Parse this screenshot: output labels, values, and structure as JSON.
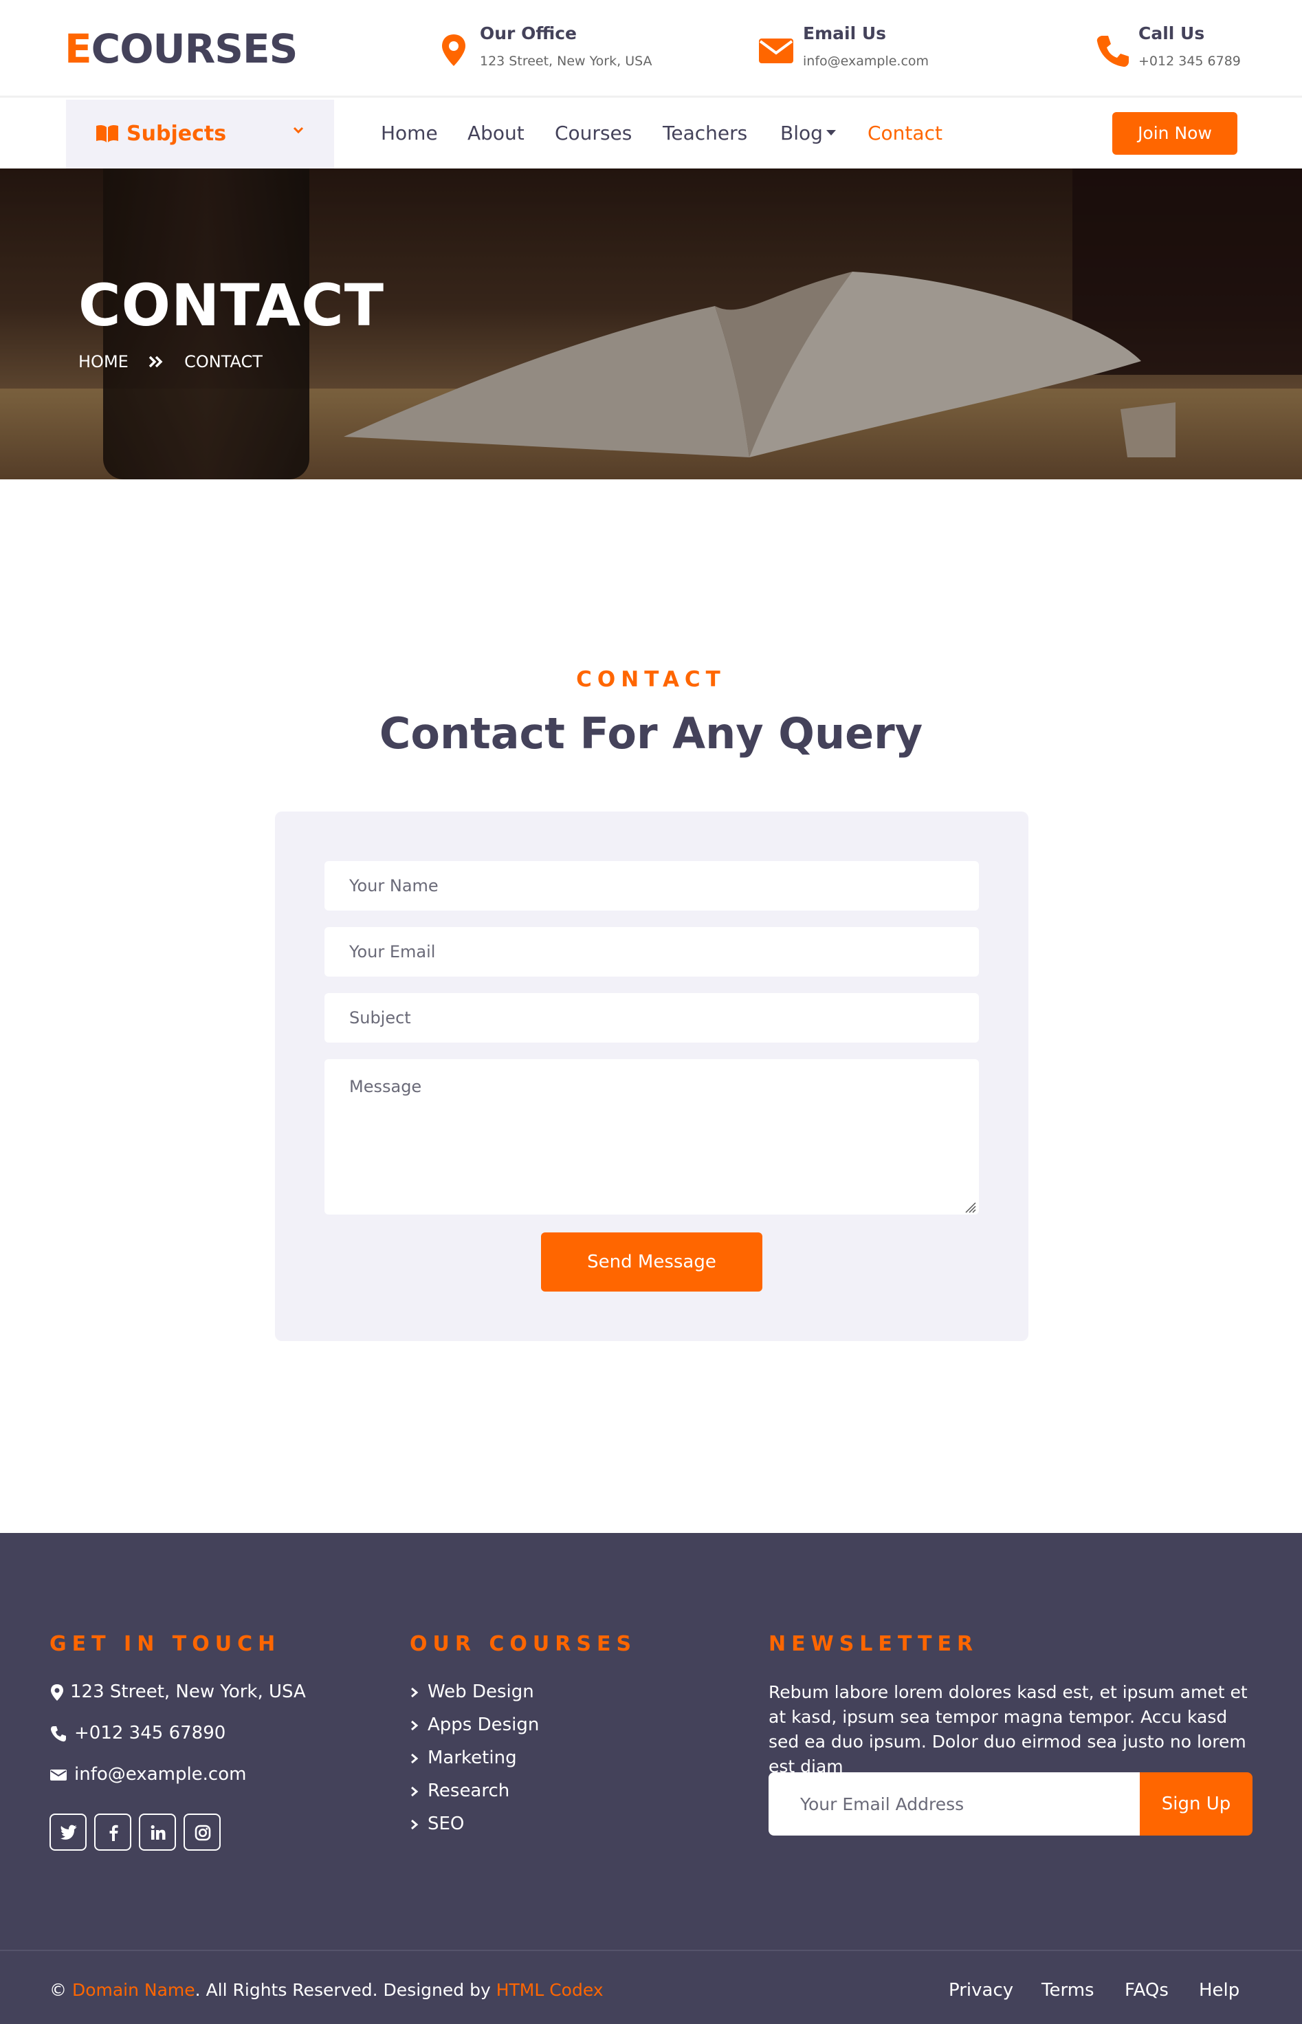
{
  "brand": {
    "logo_first": "E",
    "logo_rest": "COURSES",
    "accent": "#ff6600",
    "dark": "#44425a"
  },
  "topbar": {
    "office": {
      "title": "Our Office",
      "value": "123 Street, New York, USA",
      "icon": "map-marker-icon"
    },
    "email": {
      "title": "Email Us",
      "value": "info@example.com",
      "icon": "envelope-icon"
    },
    "call": {
      "title": "Call Us",
      "value": "+012 345 6789",
      "icon": "phone-icon"
    }
  },
  "nav": {
    "subjects_label": "Subjects",
    "links": [
      "Home",
      "About",
      "Courses",
      "Teachers",
      "Blog",
      "Contact"
    ],
    "active": "Contact",
    "join_label": "Join Now"
  },
  "hero": {
    "title": "CONTACT",
    "breadcrumb": [
      "HOME",
      "CONTACT"
    ]
  },
  "contact": {
    "kicker": "CONTACT",
    "title": "Contact For Any Query",
    "placeholders": {
      "name": "Your Name",
      "email": "Your Email",
      "subject": "Subject",
      "message": "Message"
    },
    "send_label": "Send Message"
  },
  "footer": {
    "get_in_touch": {
      "heading": "GET IN TOUCH",
      "address": "123 Street, New York, USA",
      "phone": "+012 345 67890",
      "email": "info@example.com",
      "socials": [
        "twitter-icon",
        "facebook-icon",
        "linkedin-icon",
        "instagram-icon"
      ]
    },
    "courses": {
      "heading": "OUR COURSES",
      "items": [
        "Web Design",
        "Apps Design",
        "Marketing",
        "Research",
        "SEO"
      ]
    },
    "newsletter": {
      "heading": "NEWSLETTER",
      "text": "Rebum labore lorem dolores kasd est, et ipsum amet et at kasd, ipsum sea tempor magna tempor. Accu kasd sed ea duo ipsum. Dolor duo eirmod sea justo no lorem est diam",
      "placeholder": "Your Email Address",
      "button": "Sign Up"
    },
    "copyright": {
      "symbol": "©",
      "domain": "Domain Name",
      "middle": ". All Rights Reserved. Designed by",
      "designer": "HTML Codex"
    },
    "bottom_links": [
      "Privacy",
      "Terms",
      "FAQs",
      "Help"
    ]
  }
}
